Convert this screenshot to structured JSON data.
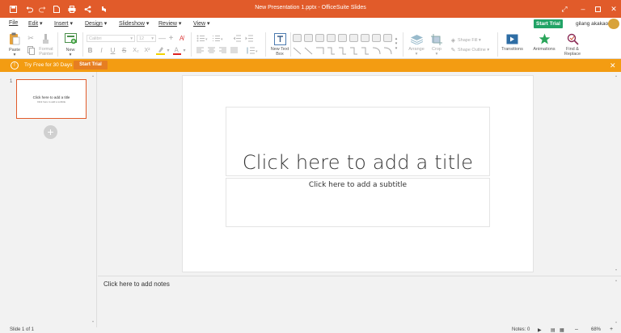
{
  "window": {
    "title": "New Presentation 1.pptx - OfficeSuite Slides"
  },
  "menu": {
    "items": [
      "File",
      "Edit",
      "Insert",
      "Design",
      "Slideshow",
      "Review",
      "View"
    ],
    "start_trial": "Start Trial",
    "username": "gilang akakao"
  },
  "ribbon": {
    "paste": "Paste",
    "format_painter": "Format Painter",
    "new": "New",
    "font_name": "Calibri",
    "font_size": "12",
    "bold": "B",
    "italic": "I",
    "underline": "U",
    "strike": "S",
    "subscript": "X₂",
    "superscript": "X²",
    "new_text_box": "New Text Box",
    "arrange": "Arrange",
    "crop": "Crop",
    "shape_fill": "Shape Fill",
    "shape_outline": "Shape Outline",
    "transitions": "Transitions",
    "animations": "Animations",
    "find_replace": "Find & Replace"
  },
  "banner": {
    "text": "Try Free for 30 Days",
    "button": "Start Trial"
  },
  "slides_panel": {
    "slide_number": "1",
    "thumb_title": "Click here to add a title",
    "thumb_subtitle": "Click here to add a subtitle"
  },
  "slide": {
    "title_placeholder": "Click here to add a title",
    "subtitle_placeholder": "Click here to add a subtitle"
  },
  "notes": {
    "placeholder": "Click here to add notes"
  },
  "status": {
    "slide_of": "Slide 1 of 1",
    "notes_label": "Notes: 0",
    "zoom": "68%"
  },
  "colors": {
    "accent": "#e15b2a",
    "trial_green": "#21a366",
    "banner_orange": "#f39c12"
  }
}
